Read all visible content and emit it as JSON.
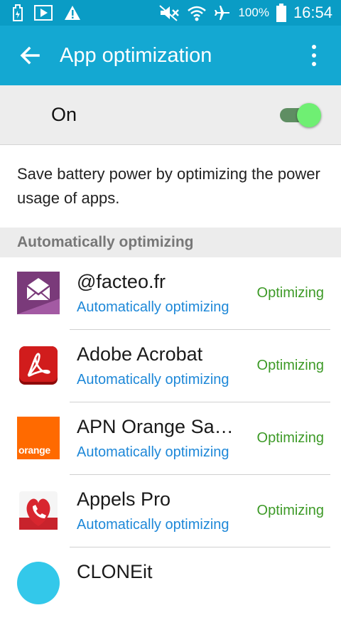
{
  "status_bar": {
    "battery_percent": "100%",
    "time": "16:54",
    "left_icons": [
      "power-saving-icon",
      "play-store-notification-icon",
      "warning-icon"
    ],
    "right_icons": [
      "mute-icon",
      "wifi-icon",
      "airplane-mode-icon",
      "battery-icon"
    ]
  },
  "app_bar": {
    "title": "App optimization",
    "back_icon": "arrow-left-icon",
    "menu_icon": "more-vert-icon"
  },
  "master_toggle": {
    "label": "On",
    "state": "on"
  },
  "description": "Save battery power by optimizing the power usage of apps.",
  "section_header": "Automatically optimizing",
  "apps": [
    {
      "name": "@facteo.fr",
      "subtitle": "Automatically optimizing",
      "status": "Optimizing",
      "icon": "facteo-app-icon"
    },
    {
      "name": "Adobe Acrobat",
      "subtitle": "Automatically optimizing",
      "status": "Optimizing",
      "icon": "adobe-acrobat-app-icon"
    },
    {
      "name": "APN Orange Sans Contact",
      "subtitle": "Automatically optimizing",
      "status": "Optimizing",
      "icon": "orange-app-icon",
      "icon_text": "orange"
    },
    {
      "name": "Appels Pro",
      "subtitle": "Automatically optimizing",
      "status": "Optimizing",
      "icon": "appels-pro-app-icon"
    },
    {
      "name": "CLONEit",
      "icon": "cloneit-app-icon"
    }
  ],
  "colors": {
    "status_bar": "#0a9cc5",
    "app_bar": "#14a8d2",
    "toggle_on": "#6fef73",
    "subtitle_blue": "#1e88d8",
    "optimizing_green": "#3d9a27"
  }
}
